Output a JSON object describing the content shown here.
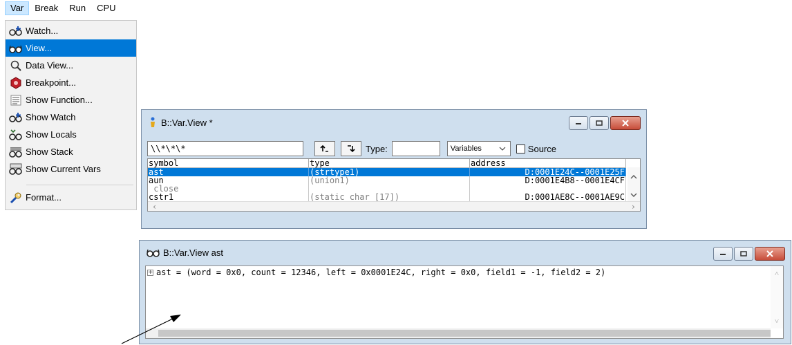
{
  "menubar": {
    "items": [
      "Var",
      "Break",
      "Run",
      "CPU"
    ]
  },
  "menu": {
    "items": [
      {
        "label": "Watch...",
        "icon": "glasses-add-icon"
      },
      {
        "label": "View...",
        "icon": "glasses-icon",
        "selected": true
      },
      {
        "label": "Data View...",
        "icon": "magnifier-icon"
      },
      {
        "label": "Breakpoint...",
        "icon": "breakpoint-icon"
      },
      {
        "label": "Show Function...",
        "icon": "list-icon"
      },
      {
        "label": "Show Watch",
        "icon": "glasses-add-icon"
      },
      {
        "label": "Show Locals",
        "icon": "locals-icon"
      },
      {
        "label": "Show Stack",
        "icon": "stack-icon"
      },
      {
        "label": "Show Current Vars",
        "icon": "current-vars-icon"
      },
      {
        "label": "Format...",
        "icon": "wrench-icon"
      }
    ]
  },
  "view_window": {
    "title": "B::Var.View *",
    "filter": "\\\\*\\*\\*",
    "type_label": "Type:",
    "type_value": "",
    "scope_select": "Variables",
    "source_label": "Source",
    "source_checked": false,
    "columns": [
      "symbol",
      "type",
      "address"
    ],
    "rows": [
      {
        "symbol": "ast",
        "type": "(strtype1)",
        "address": "D:0001E24C--0001E25F",
        "selected": true
      },
      {
        "symbol": "aun",
        "type": "(union1)",
        "address": "D:0001E4B8--0001E4CF",
        "selected": false
      },
      {
        "symbol": "_close",
        "type": "",
        "address": "",
        "selected": false
      },
      {
        "symbol": "cstr1",
        "type": "(static char [17])",
        "address": "D:0001AE8C--0001AE9C",
        "selected": false
      }
    ]
  },
  "detail_window": {
    "title": "B::Var.View ast",
    "expression": "ast = (word = 0x0, count = 12346, left = 0x0001E24C, right = 0x0, field1 = -1, field2 = 2)"
  },
  "colors": {
    "selection": "#0078d7",
    "window_frame": "#cfdfee",
    "close_button": "#c74d3a"
  }
}
